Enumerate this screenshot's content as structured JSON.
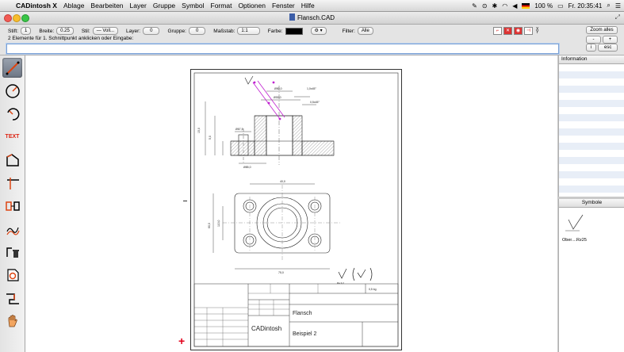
{
  "menubar": {
    "app_name": "CADintosh X",
    "items": [
      "Ablage",
      "Bearbeiten",
      "Layer",
      "Gruppe",
      "Symbol",
      "Format",
      "Optionen",
      "Fenster",
      "Hilfe"
    ],
    "battery": "100 %",
    "clock": "Fr. 20:35:41"
  },
  "window": {
    "title": "Flansch.CAD"
  },
  "toolbar": {
    "pen_label": "Stift:",
    "pen_value": "1",
    "width_label": "Breite:",
    "width_value": "0.25",
    "style_label": "Stil:",
    "style_value": "— Voll...",
    "layer_label": "Layer:",
    "layer_value": "0",
    "group_label": "Gruppe:",
    "group_value": "0",
    "scale_label": "Maßstab:",
    "scale_value": "1:1",
    "color_label": "Farbe:",
    "color_value": "#000000",
    "filter_label": "Filter:",
    "filter_value": "Alle",
    "zoom_all": "Zoom alles",
    "zoom_minus": "-",
    "zoom_plus": "+",
    "btn_i": "i",
    "btn_esc": "esc",
    "prompt": "2 Elemente für 1. Schnittpunkt anklicken oder Eingabe:",
    "command_value": ""
  },
  "palette": {
    "tools": [
      {
        "name": "line-tool-icon",
        "active": true
      },
      {
        "name": "circle-tool-icon"
      },
      {
        "name": "arc-tool-icon"
      },
      {
        "name": "text-tool",
        "label": "TEXT"
      },
      {
        "name": "polygon-tool-icon"
      },
      {
        "name": "trim-tool-icon"
      },
      {
        "name": "dimension-tool-icon"
      },
      {
        "name": "hatch-tool-icon"
      },
      {
        "name": "delete-tool-icon"
      },
      {
        "name": "symbol-tool-icon"
      },
      {
        "name": "step-tool-icon"
      },
      {
        "name": "pan-hand-icon"
      }
    ]
  },
  "drawing": {
    "dims": {
      "d1": "Ø50,0",
      "d2": "1,0x45°",
      "d3": "Ø30,0",
      "d4": "0,5x45°",
      "d5": "Ø67,5",
      "d6": "Ø85,0",
      "d7": "15,0",
      "d8": "5,0",
      "d9": "40,0",
      "d10": "75,0",
      "d11": "60,0",
      "d12": "110,0",
      "d13": "25,0",
      "d14": "12,5",
      "d15": "Ra 3,2"
    },
    "titleblock": {
      "part_name": "Flansch",
      "company": "CADintosh",
      "sheet": "Beispiel 2",
      "weight": "0,5 kg"
    }
  },
  "panels": {
    "info_title": "Information",
    "symbols_title": "Symbole",
    "symbol_item": "Ober....Rz25"
  }
}
